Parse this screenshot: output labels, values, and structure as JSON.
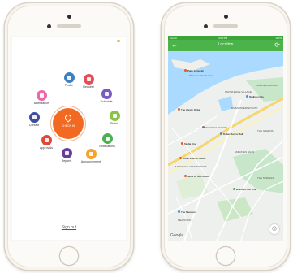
{
  "menu": {
    "center_label": "CHECK IN",
    "items": [
      {
        "id": "profile",
        "label": "Profile",
        "color": "#3b7fc4"
      },
      {
        "id": "request",
        "label": "Request",
        "color": "#e24f5b"
      },
      {
        "id": "schedule",
        "label": "Schedule",
        "color": "#7a5bc2"
      },
      {
        "id": "status",
        "label": "Status",
        "color": "#8bc34a"
      },
      {
        "id": "notifications",
        "label": "Notifications",
        "color": "#4caf50"
      },
      {
        "id": "announcement",
        "label": "Announcement",
        "color": "#f7a22b"
      },
      {
        "id": "reports",
        "label": "Reports",
        "color": "#6a3d9a"
      },
      {
        "id": "approvals",
        "label": "Approvals",
        "color": "#e2483a"
      },
      {
        "id": "contact",
        "label": "Contact",
        "color": "#3d4ea1"
      },
      {
        "id": "attendance",
        "label": "Attendance",
        "color": "#e86aa8"
      }
    ],
    "signout_label": "Sign out"
  },
  "map_screen": {
    "status_left": "Carrier",
    "status_time": "4:08 PM",
    "status_right": "100%",
    "title": "Location",
    "back_icon": "back-arrow-icon",
    "refresh_icon": "refresh-icon",
    "labels": {
      "palm": "Palm Jumeirah",
      "shoreline": "Shoreline Residences",
      "knowledge": "KNOWLEDGE VILLAGE",
      "flamingo": "FLAMINGO VILLAS",
      "dubai_internet": "DUBAI INTERNET CITY",
      "westin": "The Westin Dubai",
      "radisson": "Radisson Blu",
      "american": "American University",
      "marina": "Dubai Marina Mall",
      "media": "Media One",
      "emirates": "EMIRATES HILLS",
      "greens": "THE GREENS",
      "jumeirah_lakes": "JUMEIRAH LAKES TOWERS",
      "jebel": "Jebel Ali Golf Resort",
      "meadows": "The Meadows",
      "meadows3": "MEADOWS 3",
      "emirates_golf": "Emirates Golf Club",
      "ilsrc": "Dubai Internet Coffee",
      "springs": "THE SPRINGS",
      "google": "Google"
    }
  }
}
